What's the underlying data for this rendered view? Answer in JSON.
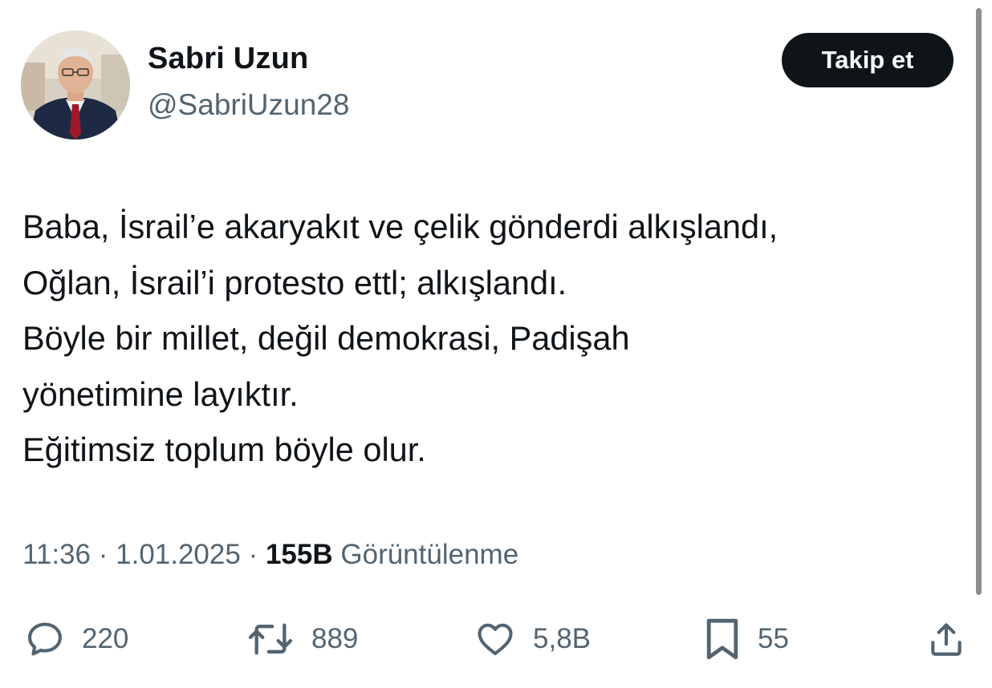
{
  "user": {
    "display_name": "Sabri Uzun",
    "handle": "@SabriUzun28",
    "follow_label": "Takip et"
  },
  "tweet": {
    "lines": [
      "Baba, İsrail’e akaryakıt ve çelik gönderdi alkışlandı,",
      "Oğlan, İsrail’i protesto ettl; alkışlandı.",
      "Böyle bir millet, değil demokrasi, Padişah",
      "yönetimine layıktır.",
      "Eğitimsiz toplum böyle olur."
    ],
    "time": "11:36",
    "date": "1.01.2025",
    "separator": "·",
    "views_count": "155B",
    "views_label": "Görüntülenme"
  },
  "actions": {
    "replies": {
      "icon": "reply-icon",
      "count": "220"
    },
    "reposts": {
      "icon": "repost-icon",
      "count": "889"
    },
    "likes": {
      "icon": "heart-icon",
      "count": "5,8B"
    },
    "bookmarks": {
      "icon": "bookmark-icon",
      "count": "55"
    },
    "share": {
      "icon": "share-icon"
    }
  },
  "colors": {
    "text_primary": "#0f1419",
    "text_secondary": "#536471",
    "button_bg": "#0f1419",
    "button_text": "#ffffff",
    "background": "#ffffff"
  }
}
